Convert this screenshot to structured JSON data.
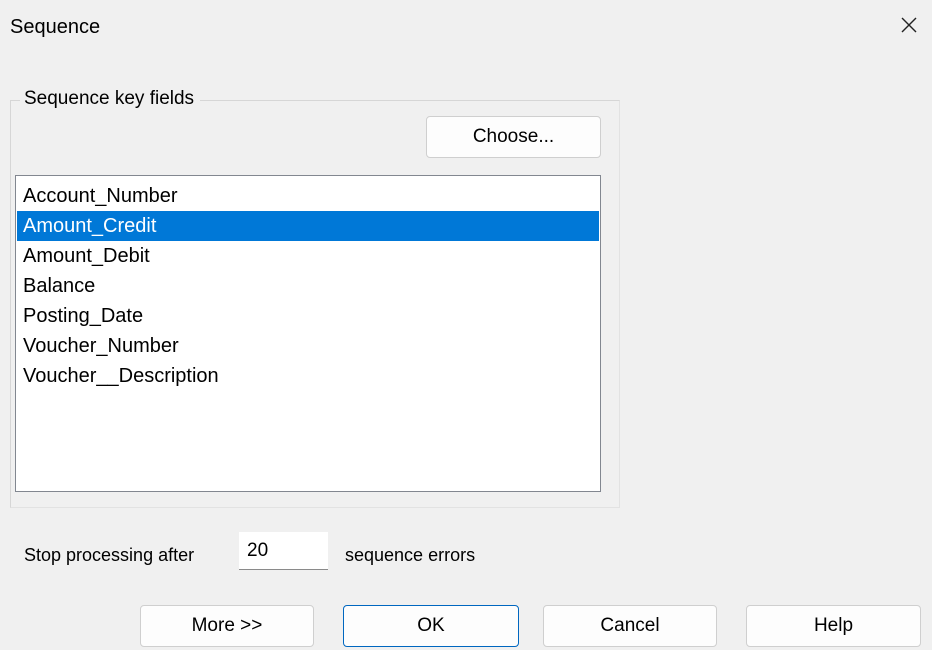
{
  "dialog": {
    "title": "Sequence"
  },
  "key_fields": {
    "group_label": "Sequence key fields",
    "choose_button": "Choose...",
    "items": [
      {
        "label": "Account_Number",
        "selected": false
      },
      {
        "label": "Amount_Credit",
        "selected": true
      },
      {
        "label": "Amount_Debit",
        "selected": false
      },
      {
        "label": "Balance",
        "selected": false
      },
      {
        "label": "Posting_Date",
        "selected": false
      },
      {
        "label": "Voucher_Number",
        "selected": false
      },
      {
        "label": "Voucher__Description",
        "selected": false
      }
    ]
  },
  "stop": {
    "label_before": "Stop processing after",
    "value": "20",
    "label_after": "sequence errors"
  },
  "buttons": {
    "more": "More >>",
    "ok": "OK",
    "cancel": "Cancel",
    "help": "Help"
  },
  "colors": {
    "selection": "#0078d7",
    "default_button_border": "#0067c0",
    "background": "#f0f0f0"
  },
  "icons": {
    "close": "close-icon"
  }
}
